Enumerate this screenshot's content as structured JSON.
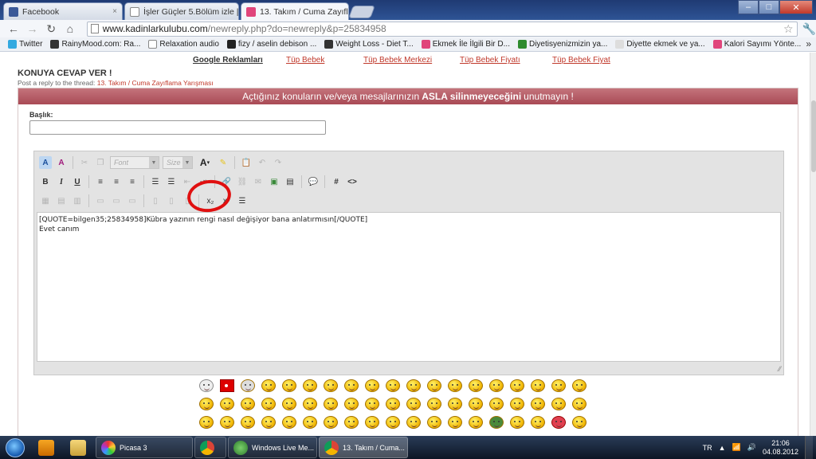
{
  "browser": {
    "tabs": [
      {
        "label": "Facebook",
        "color": "#3b5998"
      },
      {
        "label": "İşler Güçler 5.Bölüm izle | E",
        "color": "#ffffff"
      },
      {
        "label": "13. Takım / Cuma Zayıflam",
        "color": "#e0457b"
      }
    ],
    "address": {
      "host": "www.kadinlarkulubu.com",
      "path": "/newreply.php?do=newreply&p=25834958"
    },
    "bookmarks": [
      {
        "label": "Twitter",
        "color": "#33a9e0"
      },
      {
        "label": "RainyMood.com: Ra...",
        "color": "#333333"
      },
      {
        "label": "Relaxation audio",
        "color": "#ffffff"
      },
      {
        "label": "fizy / aselin debison ...",
        "color": "#222222"
      },
      {
        "label": "Weight Loss - Diet T...",
        "color": "#333333"
      },
      {
        "label": "Ekmek İle İlgili Bir D...",
        "color": "#e0457b"
      },
      {
        "label": "Diyetisyenizmizin ya...",
        "color": "#2e8b2e"
      },
      {
        "label": "Diyette ekmek ve ya...",
        "color": "#dddddd"
      },
      {
        "label": "Kalori Sayımı Yönte...",
        "color": "#e0457b"
      }
    ],
    "more": "»"
  },
  "page": {
    "ads": [
      "Google Reklamları",
      "Tüp Bebek",
      "Tüp Bebek Merkezi",
      "Tüp Bebek Fiyatı",
      "Tüp Bebek Fiyat"
    ],
    "heading": "KONUYA CEVAP VER !",
    "subheading_prefix": "Post a reply to the thread:",
    "thread_title": "13. Takım / Cuma Zayıflama Yarışması",
    "warning_pre": "Açtığınız konuların ve/veya mesajlarınızın",
    "warning_bold": "ASLA silinmeyeceğini",
    "warning_post": "unutmayın !",
    "title_label": "Başlık:",
    "title_value": ""
  },
  "editor": {
    "font_placeholder": "Font",
    "size_placeholder": "Size",
    "font_color_label": "A",
    "body_lines": [
      "[QUOTE=bilgen35;25834958]Kübra yazının rengi nasıl değişiyor bana anlatırmısın[/QUOTE]",
      "",
      "",
      "Evet canım"
    ]
  },
  "annotation": {
    "color": "#e01010"
  },
  "taskbar": {
    "tasks": [
      {
        "label": "Picasa 3"
      },
      {
        "label": ""
      },
      {
        "label": "Windows Live Me..."
      },
      {
        "label": "13. Takım / Cuma..."
      }
    ],
    "lang": "TR",
    "time": "21:06",
    "date": "04.08.2012"
  }
}
